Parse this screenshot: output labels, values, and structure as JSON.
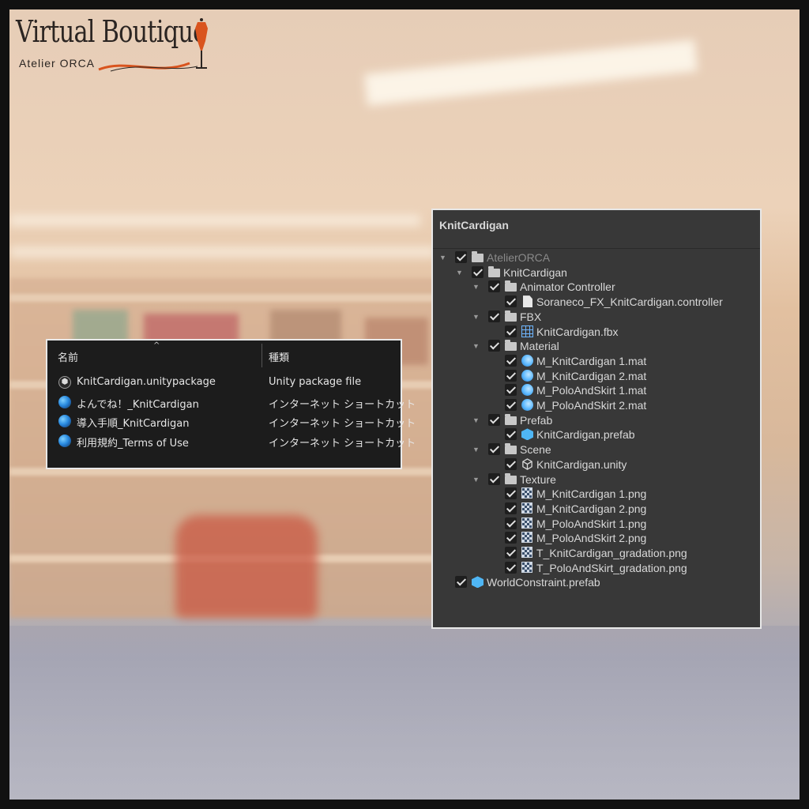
{
  "logo": {
    "title": "Virtual Boutique",
    "subtitle": "Atelier ORCA"
  },
  "explorer": {
    "columns": {
      "name": "名前",
      "type": "種類"
    },
    "rows": [
      {
        "name": "KnitCardigan.unitypackage",
        "type": "Unity package file",
        "icon": "unity-package-icon"
      },
      {
        "name": "よんでね！_KnitCardigan",
        "type": "インターネット ショートカット",
        "icon": "globe-icon"
      },
      {
        "name": "導入手順_KnitCardigan",
        "type": "インターネット ショートカット",
        "icon": "globe-icon"
      },
      {
        "name": "利用規約_Terms of Use",
        "type": "インターネット ショートカット",
        "icon": "globe-icon"
      }
    ]
  },
  "unity": {
    "title": "KnitCardigan",
    "tree": [
      {
        "label": "AtelierORCA",
        "icon": "folder",
        "depth": 0,
        "arrow": true,
        "dim": true
      },
      {
        "label": "KnitCardigan",
        "icon": "folder",
        "depth": 1,
        "arrow": true
      },
      {
        "label": "Animator Controller",
        "icon": "folder",
        "depth": 2,
        "arrow": true
      },
      {
        "label": "Soraneco_FX_KnitCardigan.controller",
        "icon": "file",
        "depth": 3
      },
      {
        "label": "FBX",
        "icon": "folder",
        "depth": 2,
        "arrow": true
      },
      {
        "label": "KnitCardigan.fbx",
        "icon": "fbx",
        "depth": 3
      },
      {
        "label": "Material",
        "icon": "folder",
        "depth": 2,
        "arrow": true
      },
      {
        "label": "M_KnitCardigan 1.mat",
        "icon": "mat",
        "depth": 3
      },
      {
        "label": "M_KnitCardigan 2.mat",
        "icon": "mat",
        "depth": 3
      },
      {
        "label": "M_PoloAndSkirt 1.mat",
        "icon": "mat",
        "depth": 3
      },
      {
        "label": "M_PoloAndSkirt 2.mat",
        "icon": "mat",
        "depth": 3
      },
      {
        "label": "Prefab",
        "icon": "folder",
        "depth": 2,
        "arrow": true
      },
      {
        "label": "KnitCardigan.prefab",
        "icon": "prefab",
        "depth": 3
      },
      {
        "label": "Scene",
        "icon": "folder",
        "depth": 2,
        "arrow": true
      },
      {
        "label": "KnitCardigan.unity",
        "icon": "unity",
        "depth": 3
      },
      {
        "label": "Texture",
        "icon": "folder",
        "depth": 2,
        "arrow": true
      },
      {
        "label": "M_KnitCardigan 1.png",
        "icon": "png",
        "depth": 3
      },
      {
        "label": "M_KnitCardigan 2.png",
        "icon": "png",
        "depth": 3
      },
      {
        "label": "M_PoloAndSkirt 1.png",
        "icon": "png",
        "depth": 3
      },
      {
        "label": "M_PoloAndSkirt 2.png",
        "icon": "png",
        "depth": 3
      },
      {
        "label": "T_KnitCardigan_gradation.png",
        "icon": "png",
        "depth": 3
      },
      {
        "label": "T_PoloAndSkirt_gradation.png",
        "icon": "png",
        "depth": 3
      },
      {
        "label": "WorldConstraint.prefab",
        "icon": "prefab",
        "depth": 0
      }
    ]
  },
  "colors": {
    "accent_logo": "#d9541e",
    "panel_dark": "#383838",
    "explorer_bg": "#1c1c1c"
  }
}
